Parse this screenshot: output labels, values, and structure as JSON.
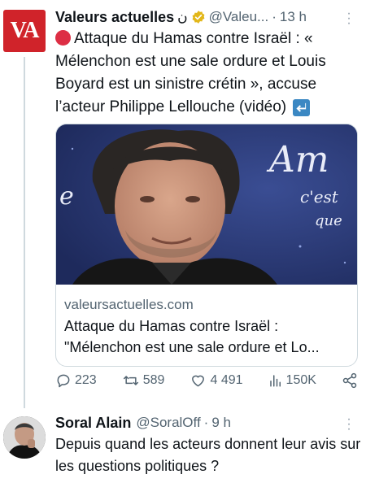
{
  "tweet1": {
    "avatar_text": "VA",
    "name": "Valeurs actuelles",
    "name_suffix": "ن",
    "handle": "@Valeu...",
    "separator": "·",
    "time": "13 h",
    "text_main": "Attaque du Hamas contre Israël : « Mélenchon est une sale ordure et Louis Boyard est un sinistre crétin », accuse l’acteur Philippe Lellouche (vidéo)",
    "card": {
      "domain": "valeursactuelles.com",
      "title_line1": "Attaque du Hamas contre Israël :",
      "title_line2": "\"Mélenchon est une sale ordure et Lo...",
      "bg_text_1": "Am",
      "bg_text_2": "c'est",
      "bg_text_3": "que",
      "bg_text_4": "e"
    },
    "actions": {
      "replies": "223",
      "retweets": "589",
      "likes": "4 491",
      "views": "150K"
    }
  },
  "tweet2": {
    "name": "Soral Alain",
    "handle": "@SoralOff",
    "separator": "·",
    "time": "9 h",
    "text": "Depuis quand les acteurs donnent leur avis sur les questions politiques ?"
  },
  "colors": {
    "brand_red": "#d0232a",
    "muted": "#536471",
    "border": "#cfd9de",
    "verified_gold": "#e2b719"
  },
  "icons": [
    "red-circle-icon",
    "down-arrow-icon",
    "verified-badge-icon",
    "reply-icon",
    "retweet-icon",
    "like-icon",
    "views-icon",
    "share-icon",
    "more-icon"
  ]
}
